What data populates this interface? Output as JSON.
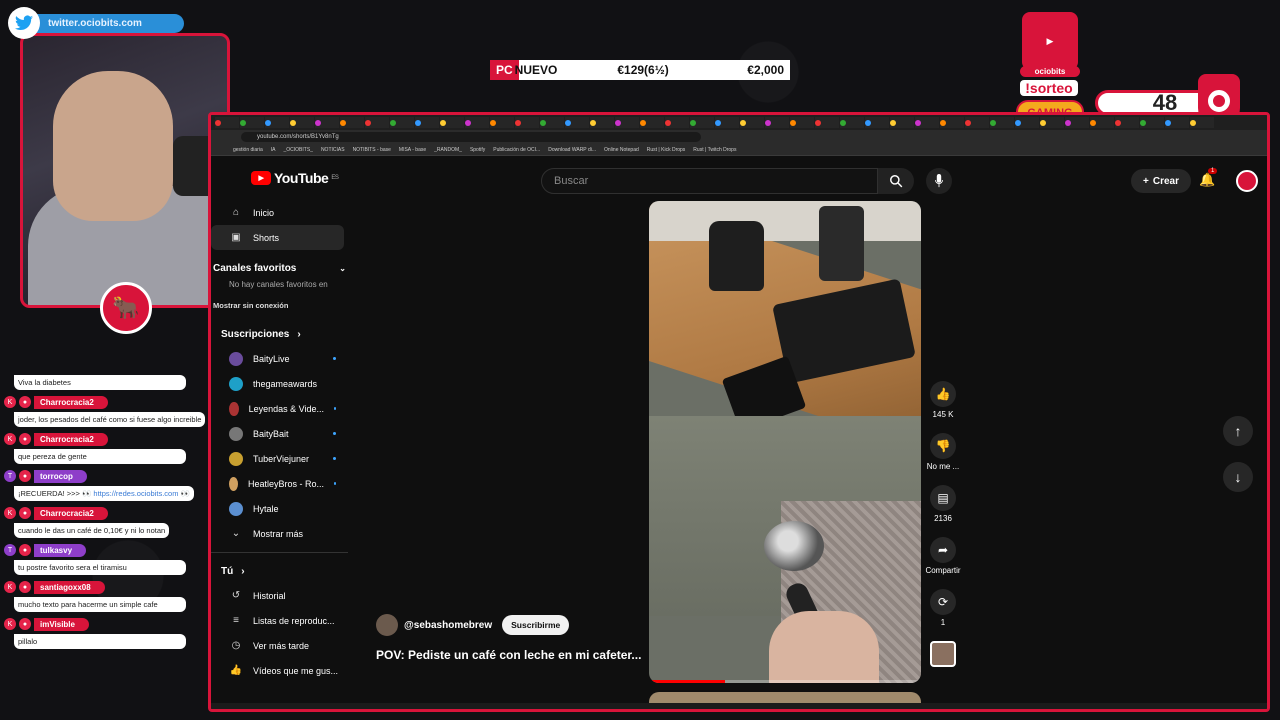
{
  "overlay": {
    "twitter_handle": "twitter.ociobits.com",
    "ticker": {
      "tag": "PC",
      "name": "NUEVO",
      "price": "€129(6½)",
      "price2": "€2,000"
    },
    "brand": "ociobits",
    "sorteo": "!sorteo",
    "gaming": "GAMING",
    "count": "48"
  },
  "chat": [
    {
      "user": "",
      "text": "Viva la diabetes",
      "platform": "none"
    },
    {
      "user": "Charrocracia2",
      "text": "joder, los pesados del café como si fuese algo increible",
      "platform": "kick"
    },
    {
      "user": "Charrocracia2",
      "text": "que pereza de gente",
      "platform": "kick"
    },
    {
      "user": "torrocop",
      "text": "¡RECUERDA! >>> 👀",
      "link": "https://redes.ociobits.com 👀",
      "platform": "twitch"
    },
    {
      "user": "Charrocracia2",
      "text": "cuando le das un café de 0,10€ y ni lo notan",
      "platform": "kick"
    },
    {
      "user": "tulkasvy",
      "text": "tu postre favorito sera el tiramisu",
      "platform": "twitch"
    },
    {
      "user": "santiagoxx08",
      "text": "mucho texto para hacerme un simple cafe",
      "platform": "kick"
    },
    {
      "user": "imVisible",
      "text": "pillalo",
      "platform": "kick"
    }
  ],
  "browser": {
    "url": "youtube.com/shorts/B1Yv8nTg",
    "bookmarks": [
      "gestión diaria",
      "IA",
      "_OCIOBITS_",
      "NOTICIAS",
      "NOTIBITS - base",
      "MISA - base",
      "_RANDOM_",
      "Spotify",
      "Publicación de OCI...",
      "Download WARP di...",
      "Online Notepad",
      "Rust | Kick Drops",
      "Rust | Twitch Drops"
    ]
  },
  "youtube": {
    "logo": "YouTube",
    "region": "ES",
    "search_placeholder": "Buscar",
    "create_label": "Crear",
    "notif_count": "1",
    "nav": {
      "home": "Inicio",
      "shorts": "Shorts"
    },
    "fav_header": "Canales favoritos",
    "fav_empty": "No hay canales favoritos en",
    "offline": "Mostrar sin conexión",
    "subs_header": "Suscripciones",
    "subscriptions": [
      {
        "name": "BaityLive",
        "live": true,
        "color": "#6a4c9c"
      },
      {
        "name": "thegameawards",
        "live": false,
        "color": "#1ea0c8"
      },
      {
        "name": "Leyendas & Vide...",
        "live": true,
        "color": "#a33"
      },
      {
        "name": "BaityBait",
        "live": true,
        "color": "#777"
      },
      {
        "name": "TuberViejuner",
        "live": true,
        "color": "#c8a030"
      },
      {
        "name": "HeatleyBros - Ro...",
        "live": true,
        "color": "#d0a060"
      },
      {
        "name": "Hytale",
        "live": false,
        "color": "#5b8fd0"
      }
    ],
    "show_more": "Mostrar más",
    "you_header": "Tú",
    "you_items": [
      "Historial",
      "Listas de reproduc...",
      "Ver más tarde",
      "Vídeos que me gus..."
    ],
    "actions": {
      "likes": "145 K",
      "dislike": "No me ...",
      "comments": "2136",
      "share": "Compartir",
      "remix": "1"
    },
    "channel": "@sebashomebrew",
    "subscribe": "Suscribirme",
    "title": "POV: Pediste un café con leche en mi cafeter..."
  }
}
